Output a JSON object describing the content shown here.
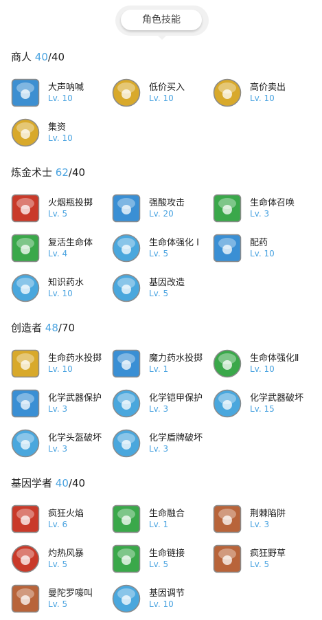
{
  "tab": {
    "label": "角色技能"
  },
  "sections": [
    {
      "name": "商人",
      "points": "40",
      "max": "/40",
      "skills": [
        {
          "name": "大声呐喊",
          "level": "Lv. 10",
          "icon": "shout-icon",
          "shape": "square",
          "color": "#3d8fd1"
        },
        {
          "name": "低价买入",
          "level": "Lv. 10",
          "icon": "dc-coin-icon",
          "shape": "circle",
          "color": "#d8a92b"
        },
        {
          "name": "高价卖出",
          "level": "Lv. 10",
          "icon": "dollar-coin-icon",
          "shape": "circle",
          "color": "#d8a92b"
        },
        {
          "name": "集资",
          "level": "Lv. 10",
          "icon": "coin-pile-icon",
          "shape": "circle",
          "color": "#d8a92b"
        }
      ]
    },
    {
      "name": "炼金术士",
      "points": "62",
      "max": "/40",
      "skills": [
        {
          "name": "火烟瓶投掷",
          "level": "Lv. 5",
          "icon": "fire-bottle-icon",
          "shape": "square",
          "color": "#c93a2a"
        },
        {
          "name": "强酸攻击",
          "level": "Lv. 20",
          "icon": "acid-flask-icon",
          "shape": "square",
          "color": "#3a8fd4"
        },
        {
          "name": "生命体召唤",
          "level": "Lv. 3",
          "icon": "summon-homunculus-icon",
          "shape": "square",
          "color": "#3aa84a"
        },
        {
          "name": "复活生命体",
          "level": "Lv. 4",
          "icon": "resurrect-homunculus-icon",
          "shape": "square",
          "color": "#3aa84a"
        },
        {
          "name": "生命体强化 I",
          "level": "Lv. 5",
          "icon": "homunculus-strength-icon",
          "shape": "circle",
          "color": "#4aa7dd"
        },
        {
          "name": "配药",
          "level": "Lv. 10",
          "icon": "potion-icon",
          "shape": "square",
          "color": "#3a8fd4"
        },
        {
          "name": "知识药水",
          "level": "Lv. 10",
          "icon": "potion-knowledge-icon",
          "shape": "circle",
          "color": "#4aa7dd"
        },
        {
          "name": "基因改造",
          "level": "Lv. 5",
          "icon": "dna-icon",
          "shape": "circle",
          "color": "#4aa7dd"
        }
      ]
    },
    {
      "name": "创造者",
      "points": "48",
      "max": "/70",
      "skills": [
        {
          "name": "生命药水投掷",
          "level": "Lv. 10",
          "icon": "potion-throw-icon",
          "shape": "square",
          "color": "#d8a92b"
        },
        {
          "name": "魔力药水投掷",
          "level": "Lv. 1",
          "icon": "mana-potion-throw-icon",
          "shape": "square",
          "color": "#3a8fd4"
        },
        {
          "name": "生命体强化Ⅱ",
          "level": "Lv. 10",
          "icon": "homunculus-strength2-icon",
          "shape": "circle",
          "color": "#3aa84a"
        },
        {
          "name": "化学武器保护",
          "level": "Lv. 3",
          "icon": "weapon-protect-icon",
          "shape": "square",
          "color": "#3a8fd4"
        },
        {
          "name": "化学铠甲保护",
          "level": "Lv. 3",
          "icon": "armor-protect-icon",
          "shape": "circle",
          "color": "#4aa7dd"
        },
        {
          "name": "化学武器破坏",
          "level": "Lv. 15",
          "icon": "weapon-break-icon",
          "shape": "circle",
          "color": "#4aa7dd"
        },
        {
          "name": "化学头盔破坏",
          "level": "Lv. 3",
          "icon": "helm-break-icon",
          "shape": "circle",
          "color": "#4aa7dd"
        },
        {
          "name": "化学盾牌破坏",
          "level": "Lv. 3",
          "icon": "shield-break-icon",
          "shape": "circle",
          "color": "#4aa7dd"
        }
      ]
    },
    {
      "name": "基因学者",
      "points": "40",
      "max": "/40",
      "skills": [
        {
          "name": "疯狂火焰",
          "level": "Lv. 6",
          "icon": "crazy-fire-icon",
          "shape": "square",
          "color": "#c93a2a"
        },
        {
          "name": "生命融合",
          "level": "Lv. 1",
          "icon": "life-fusion-icon",
          "shape": "square",
          "color": "#3aa84a"
        },
        {
          "name": "荆棘陷阱",
          "level": "Lv. 3",
          "icon": "thorn-trap-icon",
          "shape": "square",
          "color": "#b8643a"
        },
        {
          "name": "灼热风暴",
          "level": "Lv. 5",
          "icon": "hot-storm-icon",
          "shape": "circle",
          "color": "#c93a2a"
        },
        {
          "name": "生命链接",
          "level": "Lv. 5",
          "icon": "life-link-icon",
          "shape": "square",
          "color": "#3aa84a"
        },
        {
          "name": "疯狂野草",
          "level": "Lv. 5",
          "icon": "crazy-weed-icon",
          "shape": "square",
          "color": "#b8643a"
        },
        {
          "name": "曼陀罗嚎叫",
          "level": "Lv. 5",
          "icon": "mandragora-howl-icon",
          "shape": "square",
          "color": "#b8643a"
        },
        {
          "name": "基因调节",
          "level": "Lv. 10",
          "icon": "gene-adjust-icon",
          "shape": "circle",
          "color": "#4aa7dd"
        }
      ]
    }
  ]
}
